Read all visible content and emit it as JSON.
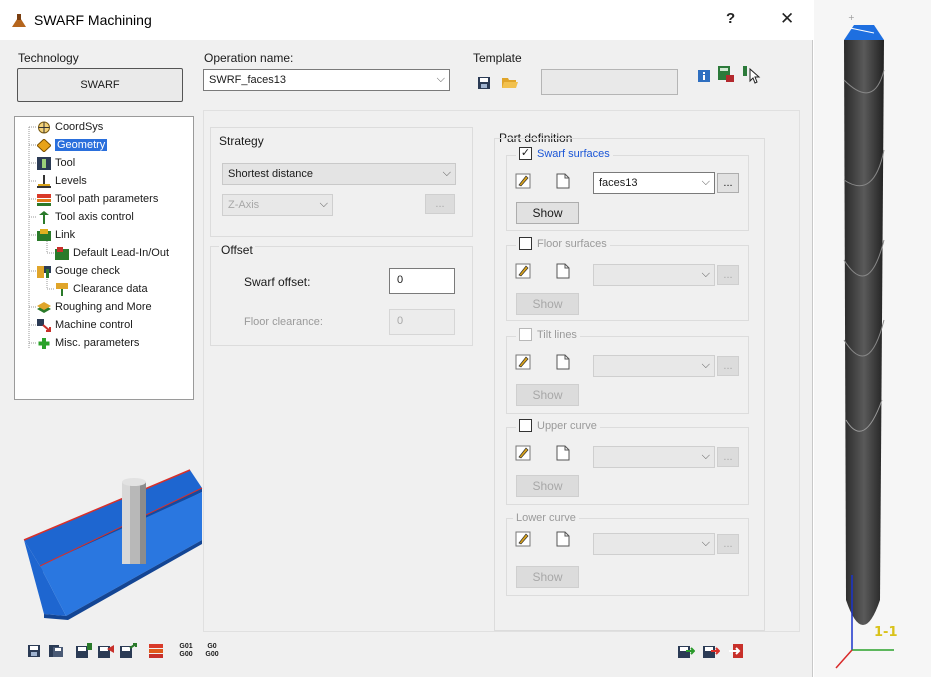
{
  "window": {
    "title": "SWARF Machining",
    "help": "?",
    "close": "✕"
  },
  "technology": {
    "label": "Technology",
    "button": "SWARF"
  },
  "operation": {
    "label": "Operation name:",
    "value": "SWRF_faces13"
  },
  "template": {
    "label": "Template",
    "value": ""
  },
  "tree": {
    "items": [
      {
        "label": "CoordSys",
        "icon": "coordsys-icon",
        "selected": false
      },
      {
        "label": "Geometry",
        "icon": "geometry-icon",
        "selected": true
      },
      {
        "label": "Tool",
        "icon": "tool-icon",
        "selected": false
      },
      {
        "label": "Levels",
        "icon": "levels-icon",
        "selected": false
      },
      {
        "label": "Tool path parameters",
        "icon": "toolpath-icon",
        "selected": false
      },
      {
        "label": "Tool axis control",
        "icon": "tool-axis-icon",
        "selected": false
      },
      {
        "label": "Link",
        "icon": "link-icon",
        "selected": false
      },
      {
        "label": "Default Lead-In/Out",
        "icon": "lead-in-out-icon",
        "selected": false
      },
      {
        "label": "Gouge check",
        "icon": "gouge-check-icon",
        "selected": false
      },
      {
        "label": "Clearance data",
        "icon": "clearance-icon",
        "selected": false
      },
      {
        "label": "Roughing and More",
        "icon": "roughing-icon",
        "selected": false
      },
      {
        "label": "Machine control",
        "icon": "machine-control-icon",
        "selected": false
      },
      {
        "label": "Misc. parameters",
        "icon": "misc-params-icon",
        "selected": false
      }
    ]
  },
  "strategy": {
    "label": "Strategy",
    "value": "Shortest distance",
    "axis": "Z-Axis",
    "more": "..."
  },
  "offset": {
    "label": "Offset",
    "swarf_offset_label": "Swarf offset:",
    "swarf_offset_value": "0",
    "floor_clearance_label": "Floor clearance:",
    "floor_clearance_value": "0"
  },
  "part_definition": {
    "label": "Part definition",
    "swarf": {
      "label": "Swarf surfaces",
      "checked": true,
      "value": "faces13",
      "show": "Show",
      "more": "..."
    },
    "floor": {
      "label": "Floor surfaces",
      "checked": false,
      "show": "Show",
      "more": "..."
    },
    "tilt": {
      "label": "Tilt lines",
      "checked": false,
      "show": "Show",
      "more": "..."
    },
    "upper": {
      "label": "Upper curve",
      "checked": false,
      "show": "Show",
      "more": "..."
    },
    "lower": {
      "label": "Lower curve",
      "show": "Show",
      "more": "..."
    }
  },
  "bottom_toolbar": {
    "g01_top": "G01",
    "g01_bottom": "G00",
    "g00_top": "G0",
    "g00_bottom": "G00"
  },
  "viewport": {
    "view_label": "1-1"
  },
  "colors": {
    "selection": "#2a6fdc",
    "accent_blue": "#1a55d6",
    "part_blue": "#1e66d0",
    "drill_dark": "#3a3a3a"
  }
}
